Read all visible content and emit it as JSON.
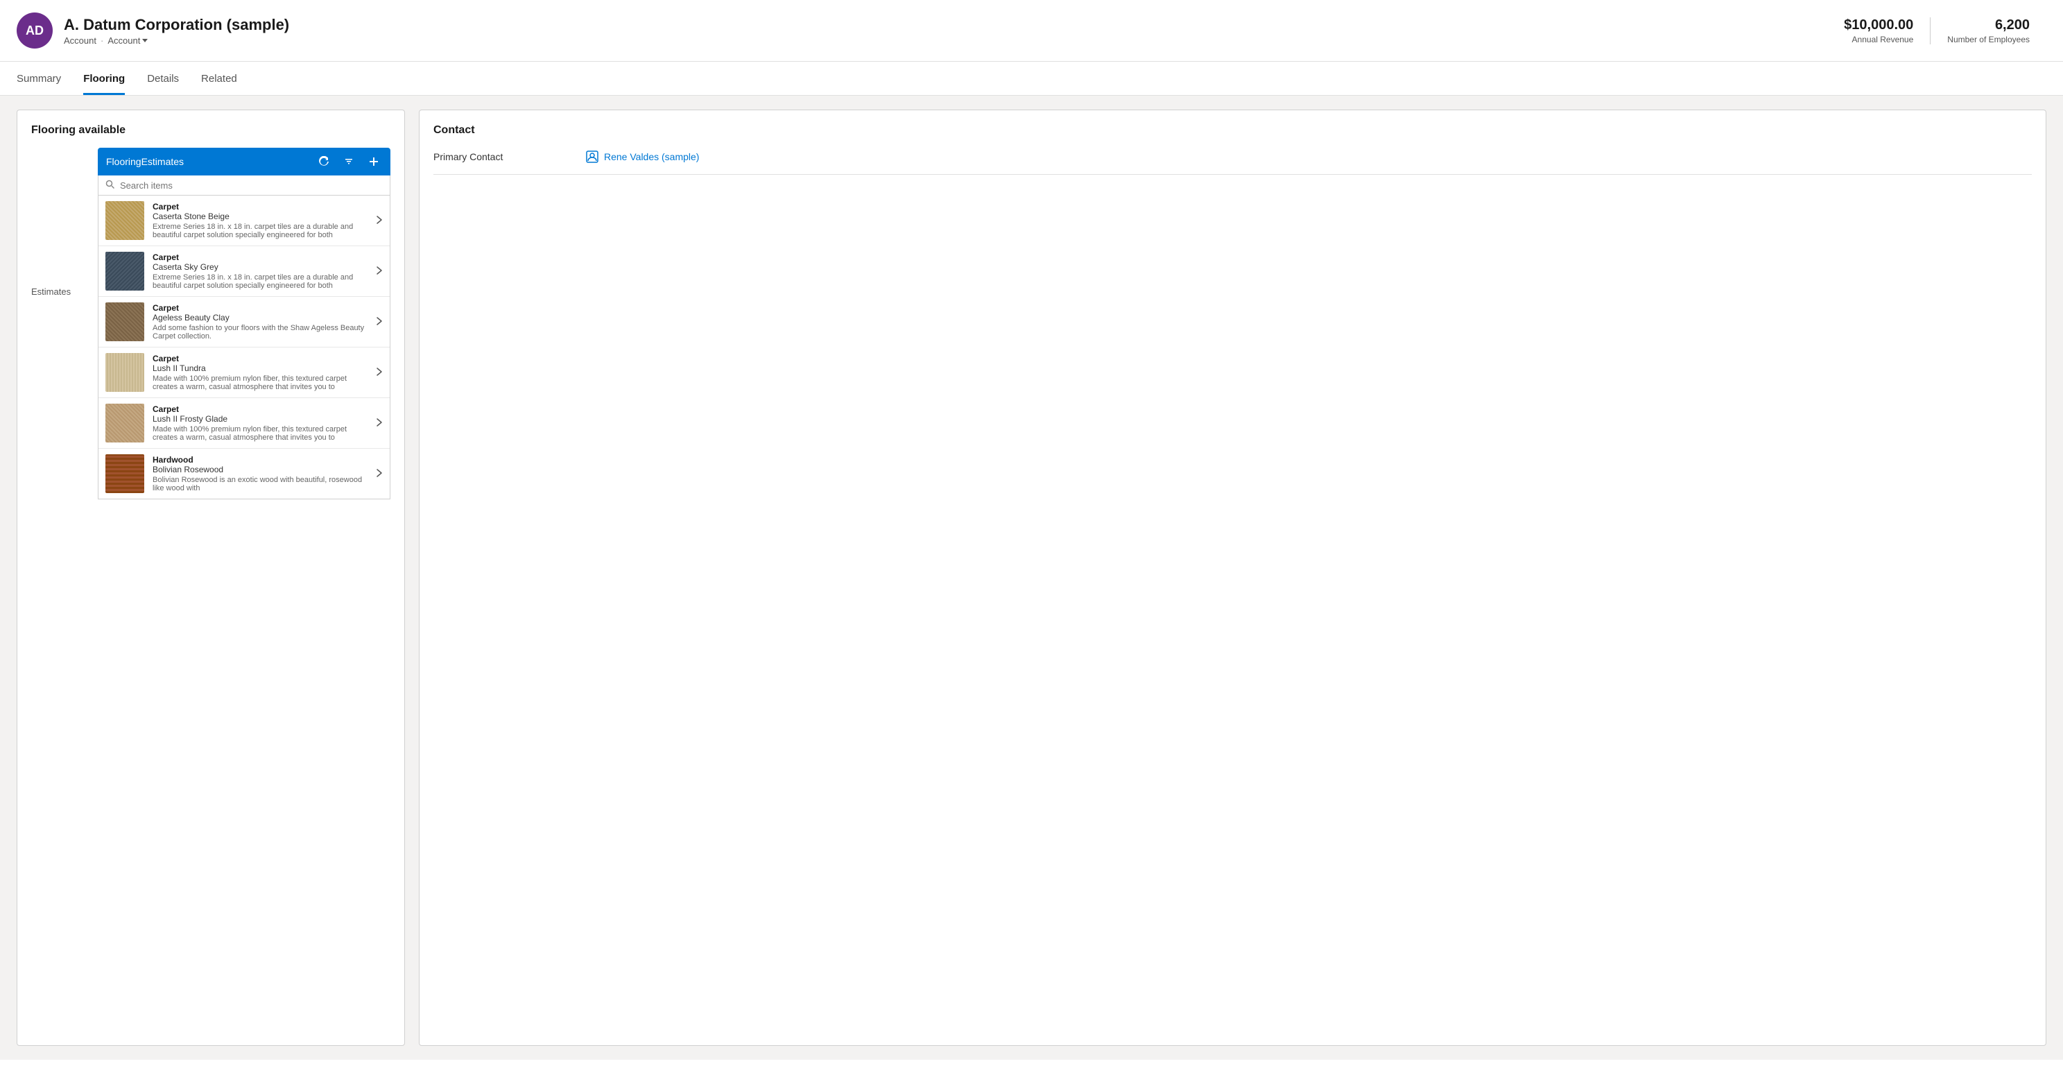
{
  "header": {
    "avatar_initials": "AD",
    "company_name": "A. Datum Corporation (sample)",
    "breadcrumb_1": "Account",
    "breadcrumb_separator": "·",
    "breadcrumb_2": "Account",
    "annual_revenue_label": "Annual Revenue",
    "annual_revenue_value": "$10,000.00",
    "employees_label": "Number of Employees",
    "employees_value": "6,200"
  },
  "nav": {
    "tabs": [
      {
        "id": "summary",
        "label": "Summary",
        "active": false
      },
      {
        "id": "flooring",
        "label": "Flooring",
        "active": true
      },
      {
        "id": "details",
        "label": "Details",
        "active": false
      },
      {
        "id": "related",
        "label": "Related",
        "active": false
      }
    ]
  },
  "flooring_panel": {
    "title": "Flooring available",
    "section_label": "Estimates",
    "toolbar_label": "FlooringEstimates",
    "search_placeholder": "Search items",
    "items": [
      {
        "category": "Carpet",
        "name": "Caserta Stone Beige",
        "desc": "Extreme Series 18 in. x 18 in. carpet tiles are a durable and beautiful carpet solution specially engineered for both",
        "swatch": "swatch-beige"
      },
      {
        "category": "Carpet",
        "name": "Caserta Sky Grey",
        "desc": "Extreme Series 18 in. x 18 in. carpet tiles are a durable and beautiful carpet solution specially engineered for both",
        "swatch": "swatch-grey"
      },
      {
        "category": "Carpet",
        "name": "Ageless Beauty Clay",
        "desc": "Add some fashion to your floors with the Shaw Ageless Beauty Carpet collection.",
        "swatch": "swatch-clay"
      },
      {
        "category": "Carpet",
        "name": "Lush II Tundra",
        "desc": "Made with 100% premium nylon fiber, this textured carpet creates a warm, casual atmosphere that invites you to",
        "swatch": "swatch-tundra"
      },
      {
        "category": "Carpet",
        "name": "Lush II Frosty Glade",
        "desc": "Made with 100% premium nylon fiber, this textured carpet creates a warm, casual atmosphere that invites you to",
        "swatch": "swatch-frosty"
      },
      {
        "category": "Hardwood",
        "name": "Bolivian Rosewood",
        "desc": "Bolivian Rosewood is an exotic wood with beautiful, rosewood like wood with",
        "swatch": "swatch-rosewood"
      }
    ]
  },
  "contact_panel": {
    "title": "Contact",
    "primary_contact_label": "Primary Contact",
    "primary_contact_name": "Rene Valdes (sample)"
  }
}
